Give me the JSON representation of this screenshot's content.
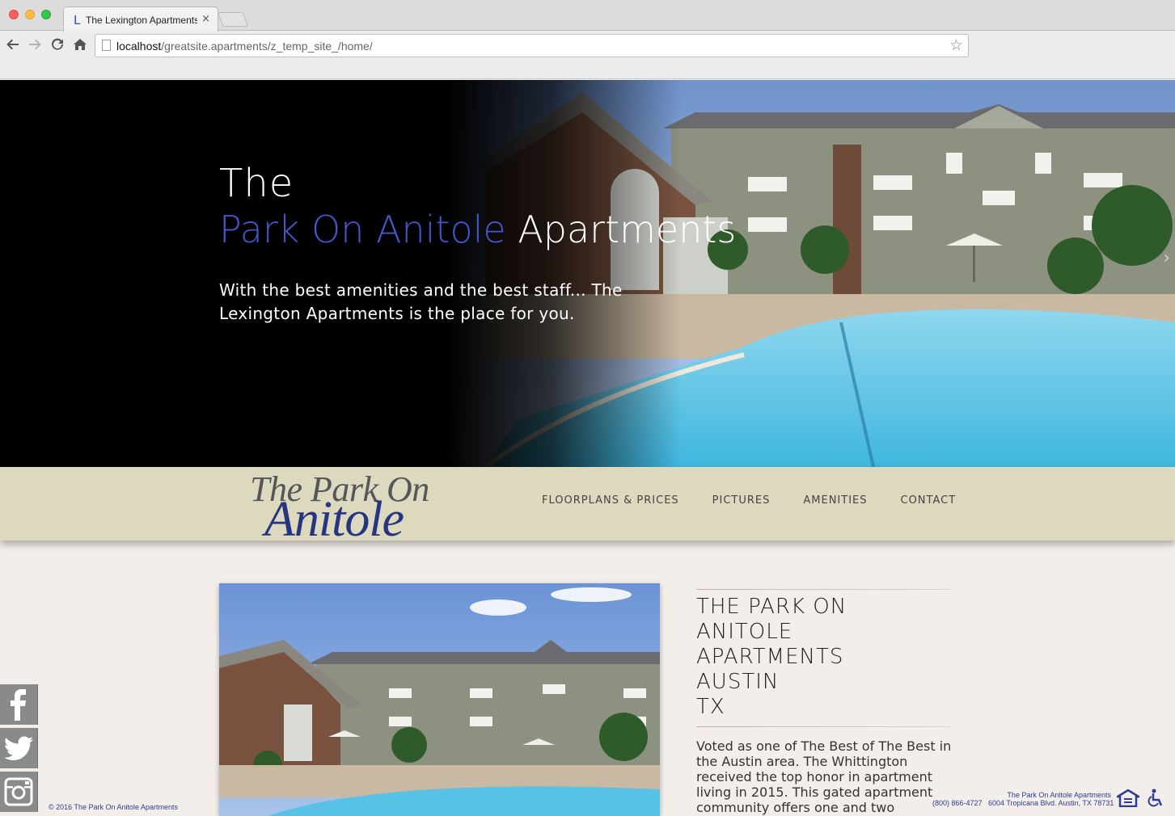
{
  "browser": {
    "tab_title": "The Lexington Apartments",
    "tab_favicon": "L",
    "tab_close": "×",
    "url_host": "localhost",
    "url_path": "/greatsite.apartments/z_temp_site_/home/",
    "icons": [
      "back-arrow-icon",
      "forward-arrow-icon",
      "reload-icon",
      "home-icon",
      "page-icon",
      "bookmark-star-icon"
    ]
  },
  "hero": {
    "line1": "The",
    "name_accent": "Park On Anitole",
    "name_rest": "Apartments",
    "subtitle": "With the best amenities and the best staff... The Lexington Apartments is the place for you.",
    "accent_color": "#4457c9"
  },
  "logo": {
    "top": "The Park On",
    "bottom": "Anitole"
  },
  "nav": {
    "items": [
      "FLOORPLANS & PRICES",
      "PICTURES",
      "AMENITIES",
      "CONTACT"
    ]
  },
  "content": {
    "heading": [
      "THE PARK ON",
      "ANITOLE",
      "APARTMENTS",
      "AUSTIN",
      "TX"
    ],
    "description": "Voted as one of The Best of The Best in the Austin area. The Whittington received the top honor in apartment living in 2015. This gated apartment community offers one and two"
  },
  "social": [
    "facebook-icon",
    "twitter-icon",
    "instagram-icon"
  ],
  "footer": {
    "copyright": "© 2016 The Park On Anitole Apartments",
    "name": "The Park On Anitole Apartments",
    "phone": "(800) 866-4727",
    "address": "6004 Tropicana Blvd. Austin, TX 78731"
  }
}
